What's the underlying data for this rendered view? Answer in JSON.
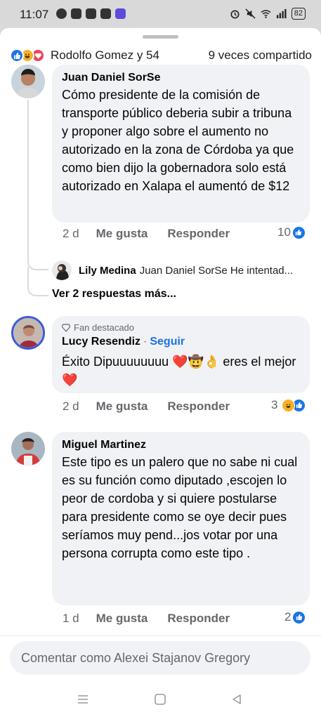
{
  "status_bar": {
    "time": "11:07",
    "battery": "82"
  },
  "reactions_bar": {
    "names": "Rodolfo Gomez y 54",
    "shares": "9 veces compartido"
  },
  "comments": [
    {
      "author": "Juan Daniel SorSe",
      "text": "Cómo presidente de la comisión de transporte público deberia subir a tribuna y proponer algo sobre el aumento no autorizado en la zona de Córdoba ya que como bien dijo la gobernadora solo está autorizado en Xalapa el aumentó de $12",
      "time": "2 d",
      "like": "Me gusta",
      "reply": "Responder",
      "reaction_count": "10"
    },
    {
      "badge": "Fan destacado",
      "author": "Lucy Resendiz",
      "follow": "Seguir",
      "separator": "·",
      "text_before": "Éxito Dipuuuuuuuu ",
      "emojis": "❤️🤠👌",
      "text_after": " eres el mejor ❤️",
      "time": "2 d",
      "like": "Me gusta",
      "reply": "Responder",
      "reaction_count": "3"
    },
    {
      "author": "Miguel Martinez",
      "text": "Este tipo es un palero que no sabe ni cual es su función como diputado ,escojen lo peor de cordoba y si quiere postularse para presidente como se oye decir pues seríamos muy pend...jos votar por una persona corrupta como este tipo .",
      "time": "1 d",
      "like": "Me gusta",
      "reply": "Responder",
      "reaction_count": "2"
    }
  ],
  "reply_preview": {
    "author": "Lily Medina",
    "text": "Juan Daniel SorSe He intentad..."
  },
  "more_replies": "Ver 2 respuestas más...",
  "composer": {
    "placeholder": "Comentar como Alexei Stajanov Gregory"
  },
  "colors": {
    "accent": "#1b74e4",
    "bubble": "#f0f2f5",
    "meta_text": "#65676b"
  }
}
